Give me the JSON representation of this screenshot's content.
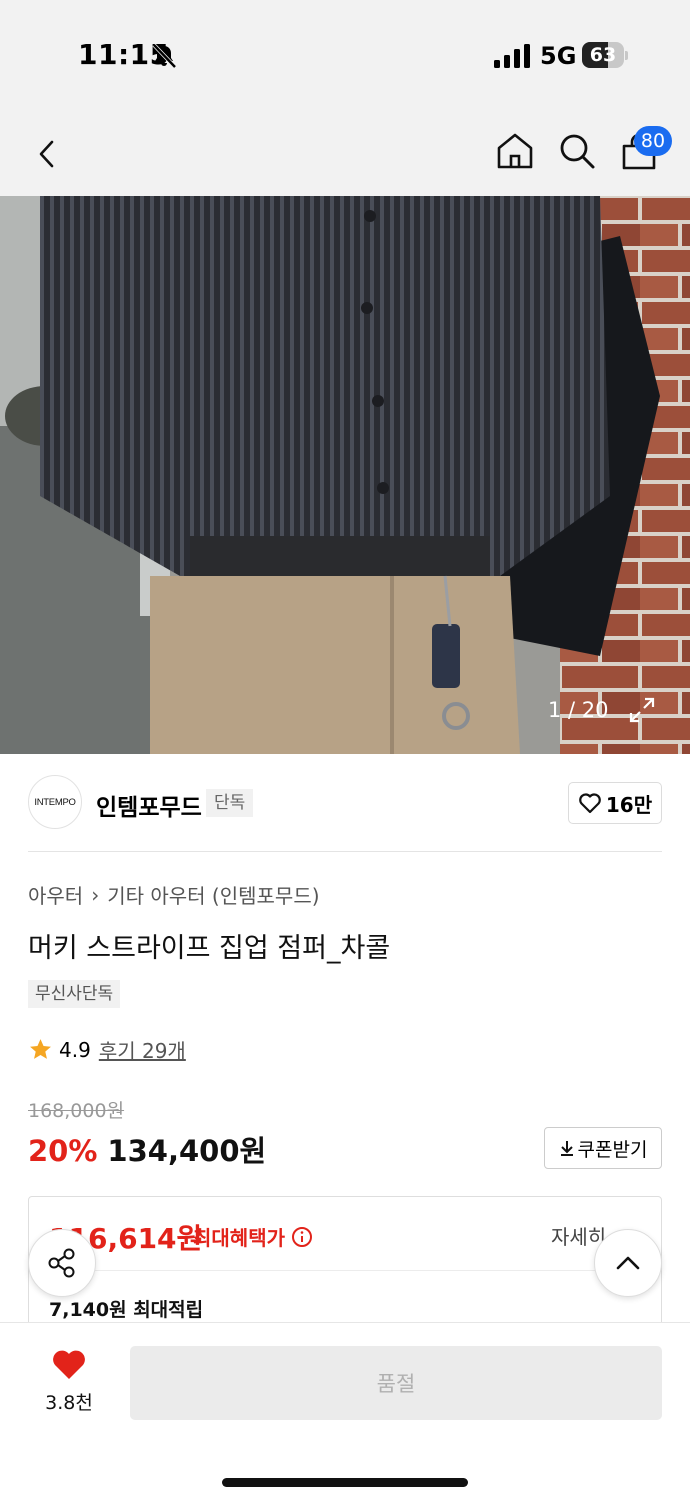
{
  "status_bar": {
    "time": "11:15",
    "network": "5G",
    "battery": "63",
    "battery_level": 0.63
  },
  "header": {
    "cart_badge": "80"
  },
  "gallery": {
    "counter": "1 / 20"
  },
  "brand": {
    "logo_text": "INTEMPO",
    "name": "인템포무드",
    "tag": "단독",
    "like_count": "16만"
  },
  "product": {
    "breadcrumb": [
      "아우터",
      "기타 아우터 (인템포무드)"
    ],
    "title": "머키 스트라이프 집업 점퍼_차콜",
    "exclusive_tag": "무신사단독",
    "rating": "4.9",
    "review_link": "후기 29개",
    "original_price": "168,000원",
    "discount": "20%",
    "sale_price": "134,400원",
    "coupon_button": "쿠폰받기"
  },
  "benefit": {
    "max_price": "116,614원",
    "max_label": "최대혜택가",
    "detail": "자세히",
    "points": "7,140원 최대적립"
  },
  "bottom": {
    "wish_count": "3.8천",
    "sold_out": "품절"
  },
  "colors": {
    "accent_red": "#e2231a",
    "badge_blue": "#1a6cf0"
  }
}
